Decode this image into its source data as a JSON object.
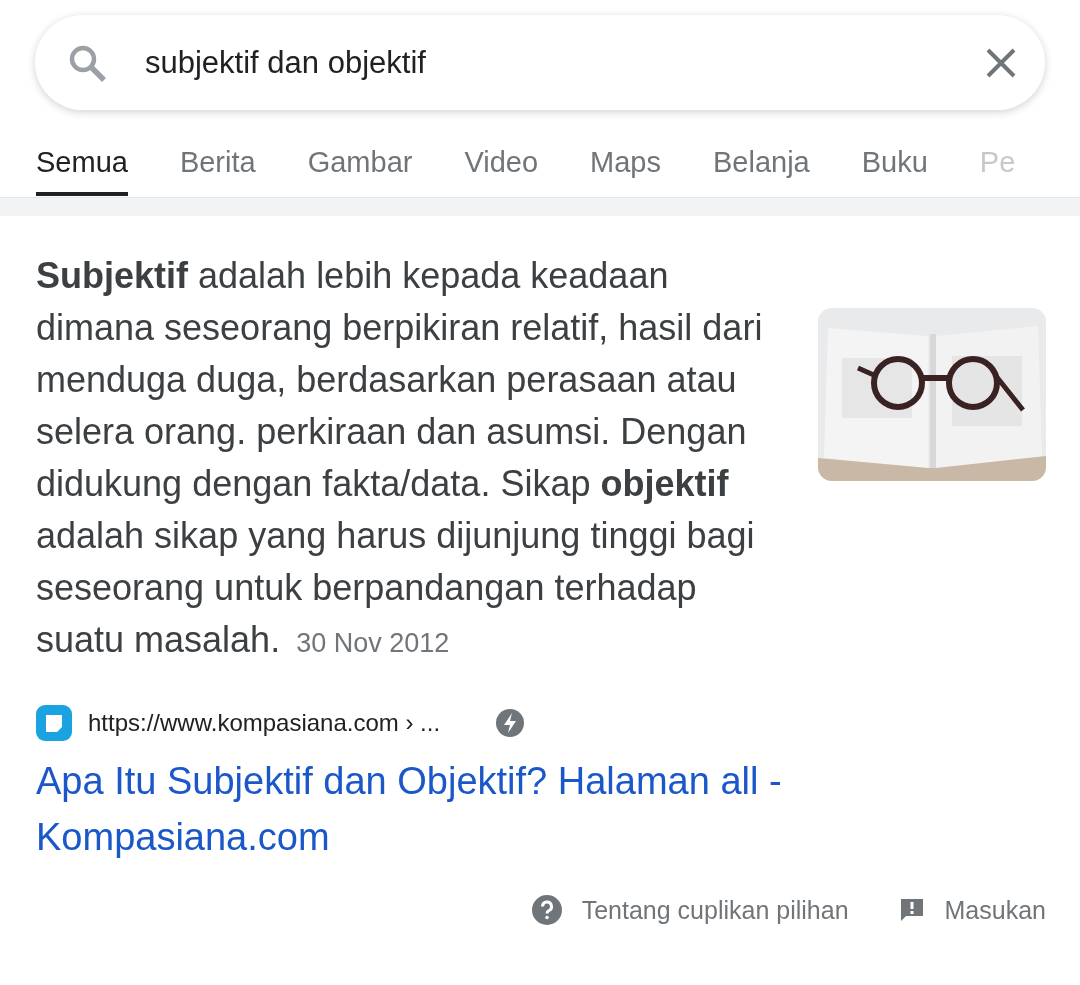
{
  "search": {
    "value": "subjektif dan objektif"
  },
  "tabs": [
    {
      "label": "Semua",
      "selected": true
    },
    {
      "label": "Berita",
      "selected": false
    },
    {
      "label": "Gambar",
      "selected": false
    },
    {
      "label": "Video",
      "selected": false
    },
    {
      "label": "Maps",
      "selected": false
    },
    {
      "label": "Belanja",
      "selected": false
    },
    {
      "label": "Buku",
      "selected": false
    },
    {
      "label": "Pe",
      "selected": false
    }
  ],
  "snippet": {
    "text": "**Subjektif** adalah lebih kepada keadaan dimana seseorang berpikiran relatif, hasil dari menduga duga, berdasarkan perasaan atau selera orang. perkiraan dan asumsi. Dengan didukung dengan fakta/data. Sikap **objektif** adalah sikap yang harus dijunjung tinggi bagi seseorang untuk berpandangan terhadap suatu masalah.",
    "date": "30 Nov 2012"
  },
  "result": {
    "url": "https://www.kompasiana.com › ...",
    "title": "Apa Itu Subjektif dan Objektif? Halaman all - Kompasiana.com"
  },
  "footer": [
    {
      "kind": "about",
      "label": "Tentang cuplikan pilihan"
    },
    {
      "kind": "feedback",
      "label": "Masukan"
    }
  ]
}
